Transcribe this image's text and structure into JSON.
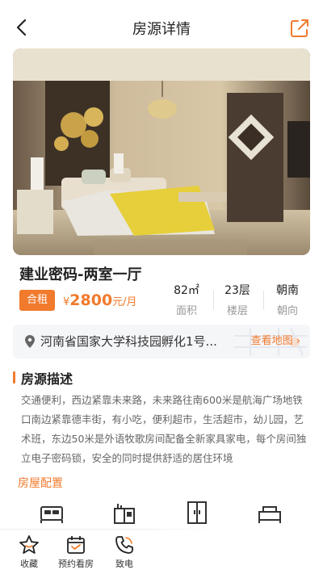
{
  "header": {
    "title": "房源详情",
    "back_icon": "chevron-left-icon",
    "share_icon": "share-icon"
  },
  "house": {
    "title": "建业密码-两室一厅",
    "tag": "合租",
    "price_symbol": "¥",
    "price_value": "2800",
    "price_unit": "元/月",
    "stats": [
      {
        "value": "82㎡",
        "label": "面积"
      },
      {
        "value": "23层",
        "label": "楼层"
      },
      {
        "value": "朝南",
        "label": "朝向"
      }
    ]
  },
  "address": {
    "text": "河南省国家大学科技园孵化1号...",
    "map_link": "查看地图 ›"
  },
  "description": {
    "title": "房源描述",
    "text": "交通便利，西边紧靠未来路，未来路往南600米是航海广场地铁口南边紧靠德丰街，有小吃，便利超市，生活超市，幼儿园，艺术班，东边50米是外语牧歌房间配备全新家具家电，每个房间独立电子密码锁，安全的同时提供舒适的居住环境"
  },
  "config": {
    "title": "房屋配置",
    "icons": [
      "bed-icon",
      "kitchen-icon",
      "wardrobe-icon",
      "sofa-icon"
    ]
  },
  "tabbar": {
    "items": [
      {
        "label": "收藏",
        "icon": "star-icon"
      },
      {
        "label": "预约看房",
        "icon": "calendar-icon"
      },
      {
        "label": "致电",
        "icon": "phone-icon"
      }
    ]
  },
  "colors": {
    "accent": "#f17a2c"
  }
}
